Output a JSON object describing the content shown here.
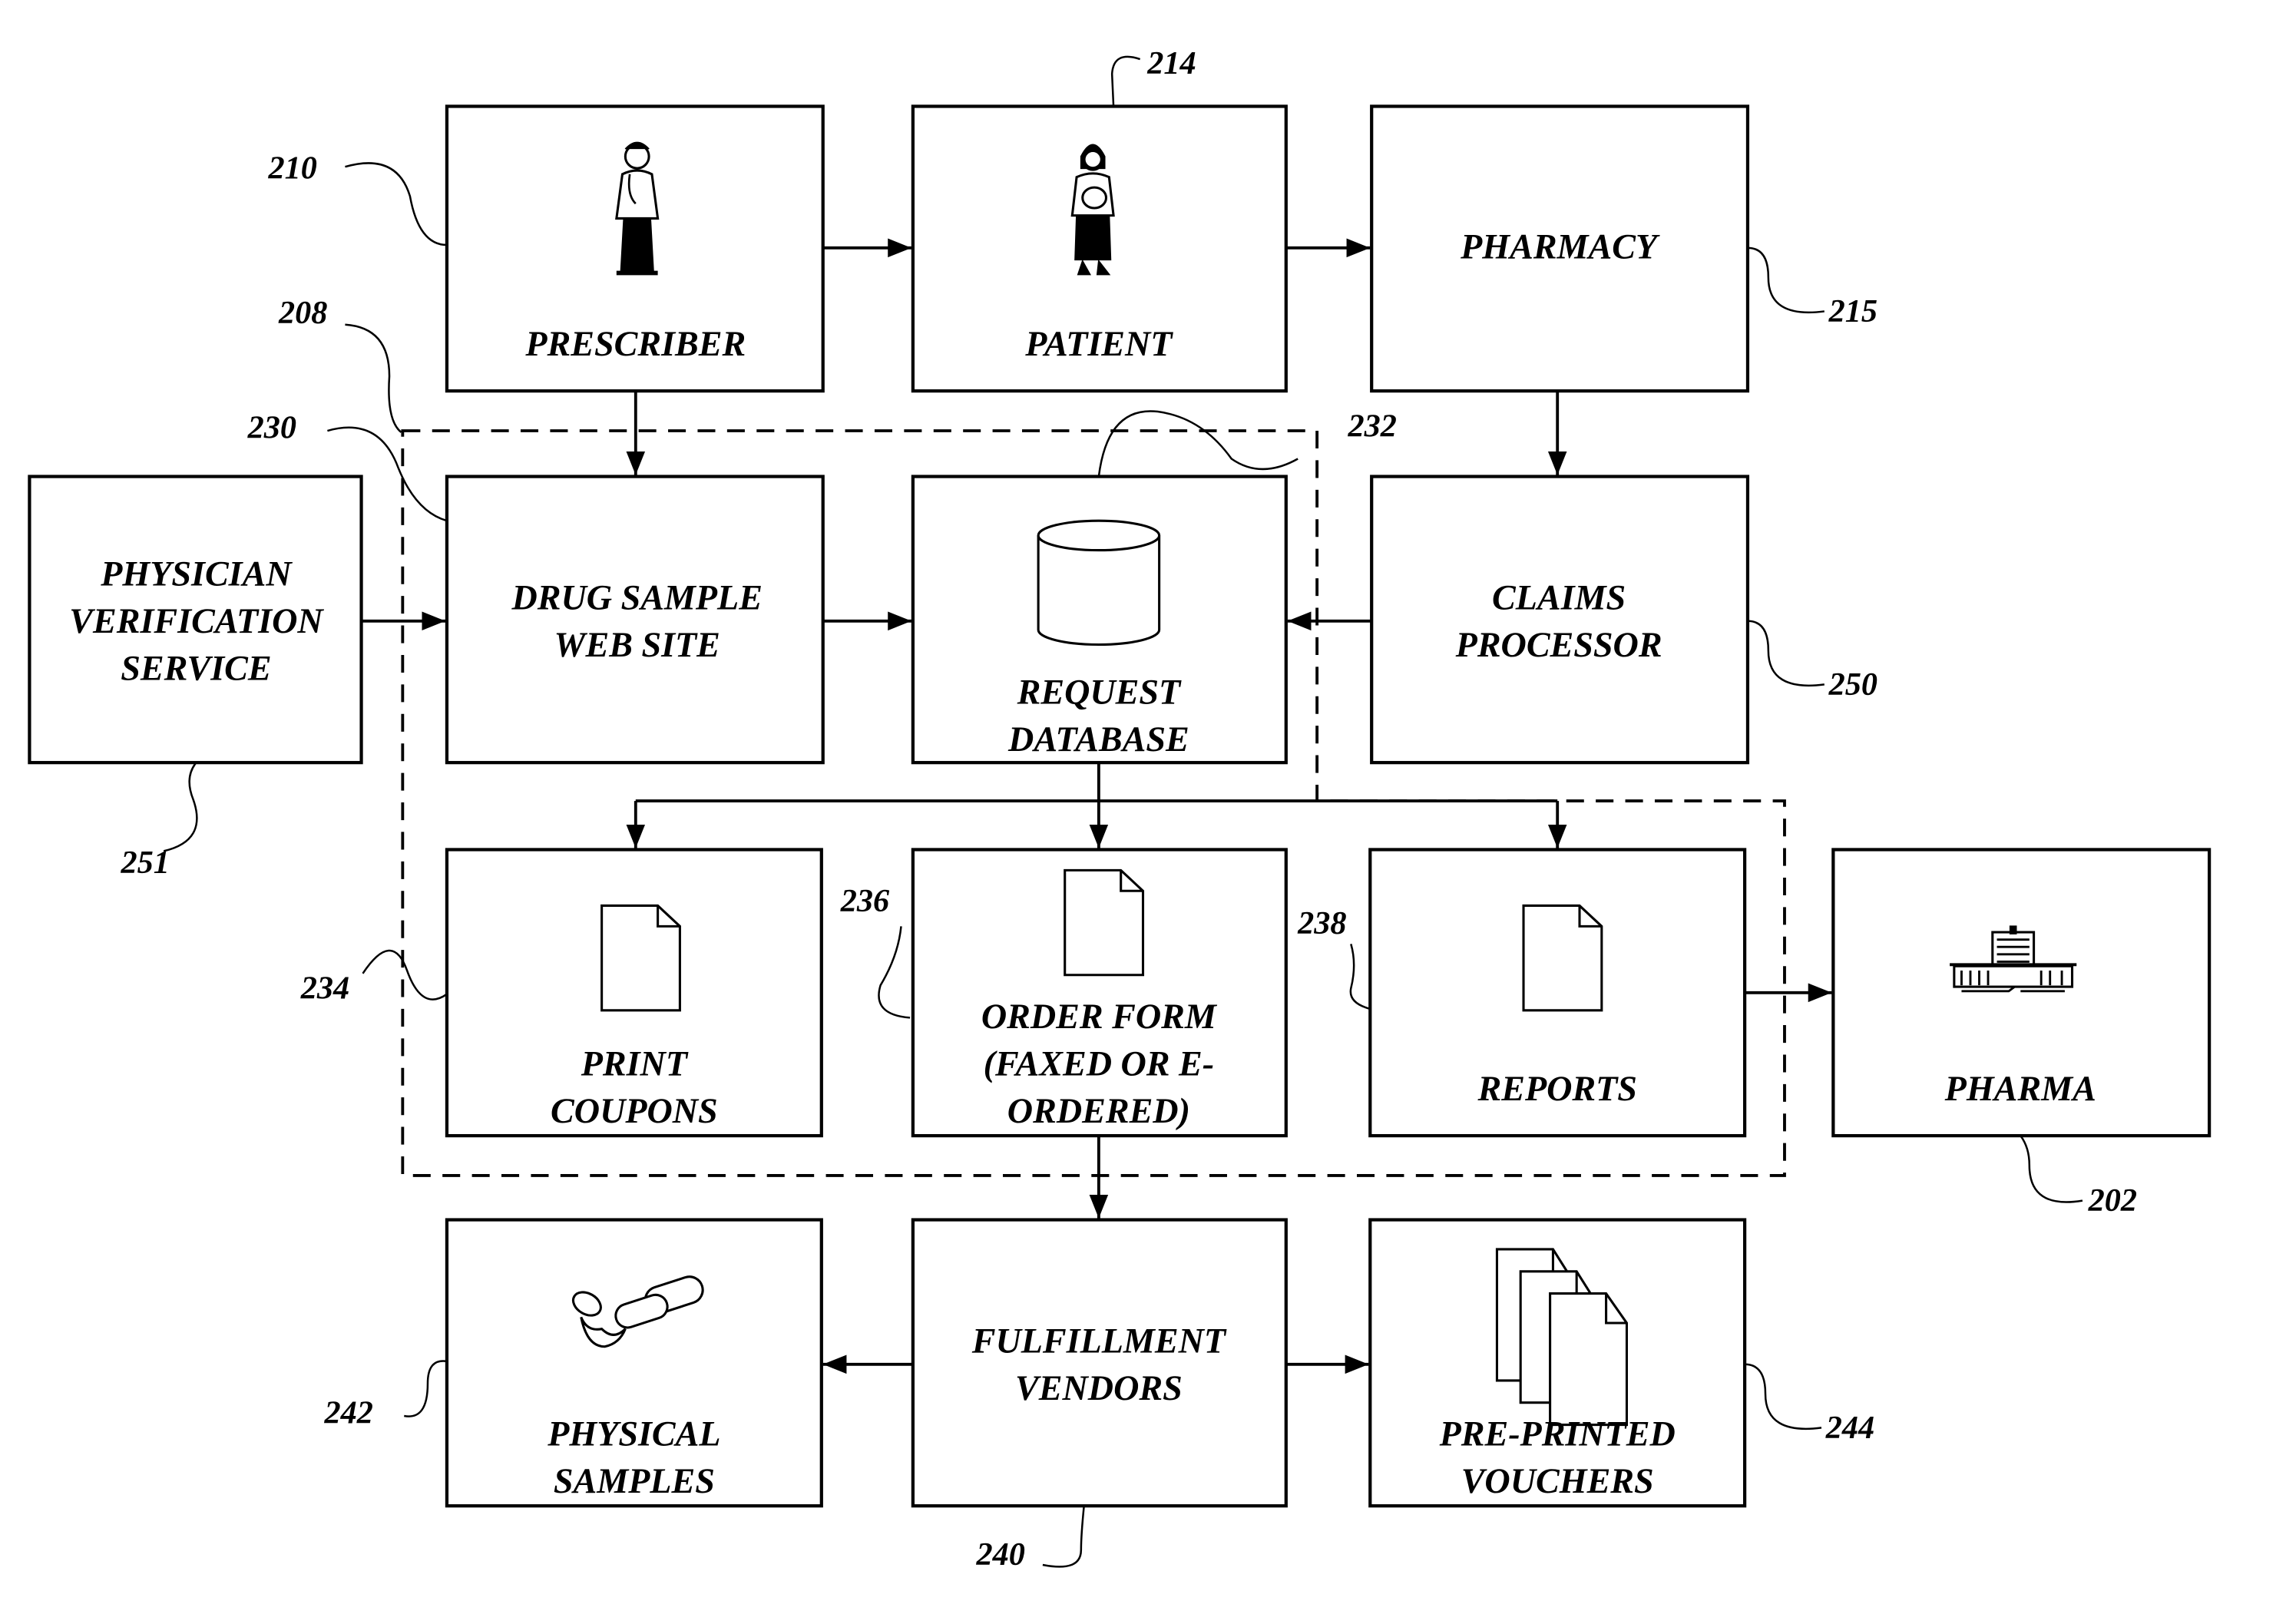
{
  "figure": {
    "nodes": {
      "prescriber": {
        "label": [
          "PRESCRIBER"
        ],
        "ref": "210",
        "icon": "doctor-icon"
      },
      "patient": {
        "label": [
          "PATIENT"
        ],
        "ref": "214",
        "icon": "patient-icon"
      },
      "pharmacy": {
        "label": [
          "PHARMACY"
        ],
        "ref": "215"
      },
      "physician_verification": {
        "label": [
          "PHYSICIAN",
          "VERIFICATION",
          "SERVICE"
        ],
        "ref": "251"
      },
      "drug_sample_web_site": {
        "label": [
          "DRUG SAMPLE",
          "WEB SITE"
        ],
        "ref": "230"
      },
      "request_database": {
        "label": [
          "REQUEST",
          "DATABASE"
        ],
        "ref": "232",
        "icon": "database-icon"
      },
      "claims_processor": {
        "label": [
          "CLAIMS",
          "PROCESSOR"
        ],
        "ref": "250"
      },
      "print_coupons": {
        "label": [
          "PRINT",
          "COUPONS"
        ],
        "ref": "234",
        "icon": "document-icon"
      },
      "order_form": {
        "label": [
          "ORDER FORM",
          "(FAXED OR E-",
          "ORDERED)"
        ],
        "ref": "236",
        "icon": "document-icon"
      },
      "reports": {
        "label": [
          "REPORTS"
        ],
        "ref": "238",
        "icon": "document-icon"
      },
      "pharma": {
        "label": [
          "PHARMA"
        ],
        "ref": "202",
        "icon": "building-icon"
      },
      "physical_samples": {
        "label": [
          "PHYSICAL",
          "SAMPLES"
        ],
        "ref": "242",
        "icon": "pills-icon"
      },
      "fulfillment_vendors": {
        "label": [
          "FULFILLMENT",
          "VENDORS"
        ],
        "ref": "240"
      },
      "pre_printed_vouchers": {
        "label": [
          "PRE-PRINTED",
          "VOUCHERS"
        ],
        "ref": "244",
        "icon": "documents-stack-icon"
      }
    },
    "dashed_region_ref": "208",
    "edges": [
      [
        "prescriber",
        "patient"
      ],
      [
        "patient",
        "pharmacy"
      ],
      [
        "prescriber",
        "drug_sample_web_site"
      ],
      [
        "pharmacy",
        "claims_processor"
      ],
      [
        "physician_verification",
        "drug_sample_web_site"
      ],
      [
        "drug_sample_web_site",
        "request_database"
      ],
      [
        "claims_processor",
        "request_database"
      ],
      [
        "request_database",
        "print_coupons"
      ],
      [
        "request_database",
        "order_form"
      ],
      [
        "request_database",
        "reports"
      ],
      [
        "reports",
        "pharma"
      ],
      [
        "order_form",
        "fulfillment_vendors"
      ],
      [
        "fulfillment_vendors",
        "physical_samples"
      ],
      [
        "fulfillment_vendors",
        "pre_printed_vouchers"
      ]
    ]
  }
}
